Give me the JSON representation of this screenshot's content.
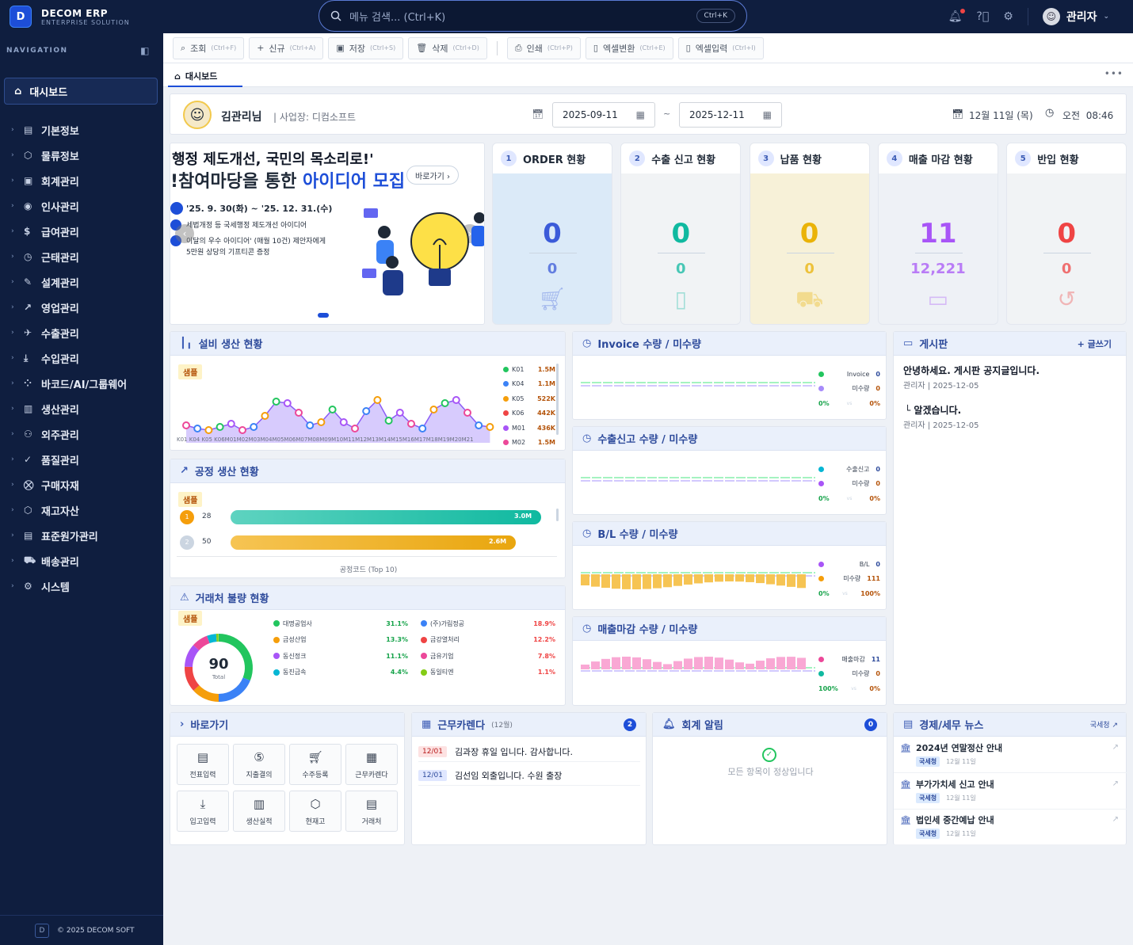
{
  "app": {
    "name": "DECOM ERP",
    "subtitle": "ENTERPRISE SOLUTION",
    "logo_letter": "D"
  },
  "search": {
    "placeholder": "메뉴 검색... (Ctrl+K)",
    "shortcut": "Ctrl+K"
  },
  "user": {
    "name": "관리자"
  },
  "nav": {
    "header": "NAVIGATION",
    "dashboard": "대시보드",
    "items": [
      "기본정보",
      "물류정보",
      "회계관리",
      "인사관리",
      "급여관리",
      "근태관리",
      "설계관리",
      "영업관리",
      "수출관리",
      "수입관리",
      "바코드/AI/그룹웨어",
      "생산관리",
      "외주관리",
      "품질관리",
      "구매자재",
      "재고자산",
      "표준원가관리",
      "배송관리",
      "시스템"
    ],
    "footer": "© 2025 DECOM SOFT",
    "footer_logo": "D"
  },
  "toolbar": [
    {
      "label": "조회",
      "key": "(Ctrl+F)"
    },
    {
      "label": "신규",
      "key": "(Ctrl+A)"
    },
    {
      "label": "저장",
      "key": "(Ctrl+S)"
    },
    {
      "label": "삭제",
      "key": "(Ctrl+D)"
    },
    {
      "label": "인쇄",
      "key": "(Ctrl+P)"
    },
    {
      "label": "엑셀변환",
      "key": "(Ctrl+E)"
    },
    {
      "label": "엑셀입력",
      "key": "(Ctrl+I)"
    }
  ],
  "tab": {
    "label": "대시보드"
  },
  "welcome": {
    "name": "김관리님",
    "company": "| 사업장: 디컴소프트",
    "date_from": "2025-09-11",
    "date_to": "2025-12-11",
    "sep": "~",
    "today": "12월 11일 (목)",
    "time": "오전  08:46"
  },
  "banner": {
    "line1": "행정 제도개선, 국민의 목소리로!'",
    "line2a": "!참여마당을 통한 ",
    "line2b": "아이디어 모집",
    "goto": "바로가기",
    "period": "'25. 9. 30(화) ~ '25. 12. 31.(수)",
    "d1": "세법개정 등 국세행정 제도개선 아이디어",
    "d2": "이달의 우수 아이디어' (매월 10건) 제안자에게",
    "d3": "5만원 상당의 기프티콘 증정"
  },
  "kpis": [
    {
      "n": "1",
      "title": "ORDER 현황",
      "big": "0",
      "small": "0",
      "bg": "#dbeaf8",
      "color": "#3b5bd9"
    },
    {
      "n": "2",
      "title": "수출 신고 현황",
      "big": "0",
      "small": "0",
      "bg": "#f1f3f5",
      "color": "#10b9a0"
    },
    {
      "n": "3",
      "title": "납품 현황",
      "big": "0",
      "small": "0",
      "bg": "#f7f1d8",
      "color": "#eab308"
    },
    {
      "n": "4",
      "title": "매출 마감 현황",
      "big": "11",
      "small": "12,221",
      "bg": "#eef1f6",
      "color": "#a855f7"
    },
    {
      "n": "5",
      "title": "반입 현황",
      "big": "0",
      "small": "0",
      "bg": "#f1f3f5",
      "color": "#ef4444"
    }
  ],
  "equip": {
    "title": "설비 생산 현황",
    "sample": "샘플",
    "xlabels": "K01 K04 K05 K06M01M02M03M04M05M06M07M08M09M10M11M12M13M14M15M16M17M18M19M20M21",
    "legend": [
      {
        "k": "K01",
        "v": "1.5M",
        "c": "#22c55e"
      },
      {
        "k": "K04",
        "v": "1.1M",
        "c": "#3b82f6"
      },
      {
        "k": "K05",
        "v": "522K",
        "c": "#f59e0b"
      },
      {
        "k": "K06",
        "v": "442K",
        "c": "#ef4444"
      },
      {
        "k": "M01",
        "v": "436K",
        "c": "#a855f7"
      },
      {
        "k": "M02",
        "v": "1.5M",
        "c": "#ec4899"
      }
    ]
  },
  "process": {
    "title": "공정 생산 현황",
    "sample": "샘플",
    "footer": "공정코드 (Top 10)",
    "bars": [
      {
        "rank": "1",
        "code": "28",
        "value": "3.0M",
        "fill": 0.98
      },
      {
        "rank": "2",
        "code": "50",
        "value": "2.6M",
        "fill": 0.9
      }
    ]
  },
  "defect": {
    "title": "거래처 불량 현황",
    "sample": "샘플",
    "total": "90",
    "total_label": "Total",
    "items": [
      {
        "name": "대명공업사",
        "pct": "31.1%",
        "c": "#22c55e"
      },
      {
        "name": "(주)가림정공",
        "pct": "18.9%",
        "c": "#3b82f6"
      },
      {
        "name": "금성산업",
        "pct": "13.3%",
        "c": "#f59e0b"
      },
      {
        "name": "금강열처리",
        "pct": "12.2%",
        "c": "#ef4444"
      },
      {
        "name": "동신정크",
        "pct": "11.1%",
        "c": "#a855f7"
      },
      {
        "name": "금유기업",
        "pct": "7.8%",
        "c": "#ec4899"
      },
      {
        "name": "동진금속",
        "pct": "4.4%",
        "c": "#06b6d4"
      },
      {
        "name": "동일티엔",
        "pct": "1.1%",
        "c": "#84cc16"
      }
    ]
  },
  "qty": [
    {
      "title": "Invoice 수량 / 미수량",
      "l1": "Invoice",
      "v1": "0",
      "l2": "미수량",
      "v2": "0",
      "p1": "0%",
      "p2": "0%",
      "vs": "vs"
    },
    {
      "title": "수출신고 수량 / 미수량",
      "l1": "수출신고",
      "v1": "0",
      "l2": "미수량",
      "v2": "0",
      "p1": "0%",
      "p2": "0%",
      "vs": "vs"
    },
    {
      "title": "B/L 수량 / 미수량",
      "l1": "B/L",
      "v1": "0",
      "l2": "미수량",
      "v2": "111",
      "p1": "0%",
      "p2": "100%",
      "vs": "vs"
    },
    {
      "title": "매출마감 수량 / 미수량",
      "l1": "매출마감",
      "v1": "11",
      "l2": "미수량",
      "v2": "0",
      "p1": "100%",
      "p2": "0%",
      "vs": "vs"
    }
  ],
  "board": {
    "title": "게시판",
    "write": "+ 글쓰기",
    "posts": [
      {
        "t": "안녕하세요. 게시판 공지글입니다.",
        "m": "관리자 | 2025-12-05"
      },
      {
        "t": "└ 알겠습니다.",
        "m": "관리자 | 2025-12-05"
      }
    ]
  },
  "shortcut": {
    "title": "바로가기",
    "items": [
      "전표입력",
      "지출결의",
      "수주등록",
      "근무카렌다",
      "입고입력",
      "생산실적",
      "현재고",
      "거래처"
    ]
  },
  "calendar": {
    "title": "근무카렌다",
    "month": "(12월)",
    "count": "2",
    "events": [
      {
        "d": "12/01",
        "t": "김과장 휴일 입니다. 감사합니다."
      },
      {
        "d": "12/01",
        "t": "김선임 외출입니다. 수원 출장"
      }
    ]
  },
  "alert": {
    "title": "회계 알림",
    "count": "0",
    "msg": "모든 항목이 정상입니다"
  },
  "news": {
    "title": "경제/세무 뉴스",
    "link": "국세청",
    "items": [
      {
        "t": "2024년 연말정산 안내",
        "src": "국세청",
        "d": "12월 11일"
      },
      {
        "t": "부가가치세 신고 안내",
        "src": "국세청",
        "d": "12월 11일"
      },
      {
        "t": "법인세 중간예납 안내",
        "src": "국세청",
        "d": "12월 11일"
      }
    ]
  }
}
